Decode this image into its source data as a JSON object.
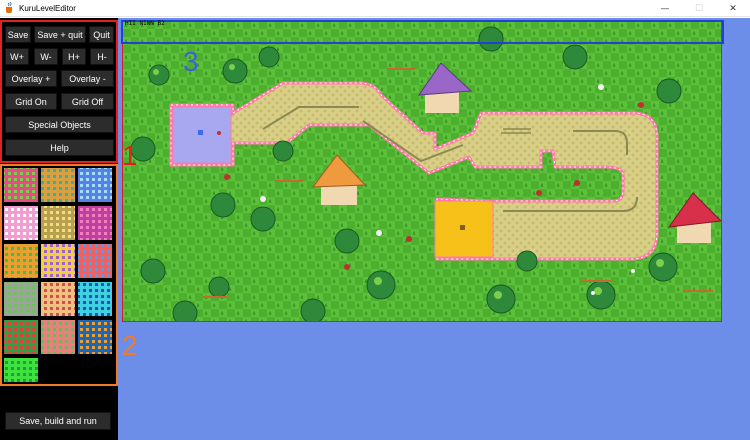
{
  "window": {
    "title": "KuruLevelEditor",
    "minimize": "—",
    "maximize": "☐",
    "close": "✕"
  },
  "toolbar": {
    "save": "Save",
    "save_quit": "Save + quit",
    "quit": "Quit",
    "w_plus": "W+",
    "w_minus": "W-",
    "h_plus": "H+",
    "h_minus": "H-",
    "overlay_plus": "Overlay +",
    "overlay_minus": "Overlay -",
    "grid_on": "Grid On",
    "grid_off": "Grid Off",
    "special_objects": "Special Objects",
    "help": "Help",
    "save_build_run": "Save, build and run"
  },
  "annotations": {
    "one": "1",
    "two": "2",
    "three": "3"
  },
  "map": {
    "overlay_label": "HII N1NN B2"
  },
  "colors": {
    "accent_red": "#e32020",
    "accent_orange": "#f07a28",
    "accent_blue": "#2040d8",
    "grass": "#4caf2e",
    "path": "#d9cf86",
    "path_border": "#ff7aa8",
    "start_zone": "#a8a8f0",
    "goal_zone": "#f6c21a",
    "background": "#6c8ee8"
  },
  "icons": {
    "app": "java-cup-icon"
  }
}
